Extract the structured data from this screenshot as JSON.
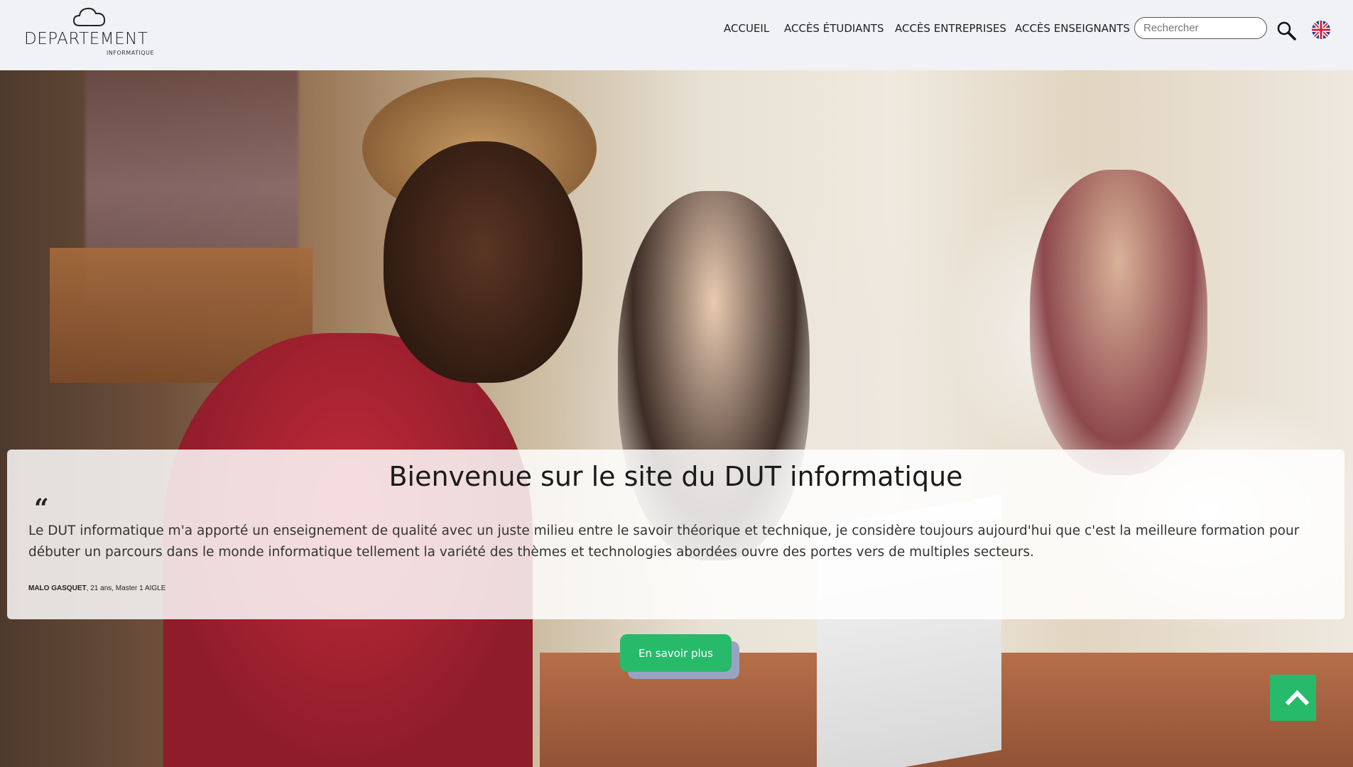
{
  "header": {
    "logo": {
      "title": "DEPARTEMENT",
      "subtitle": "INFORMATIQUE"
    },
    "nav": [
      {
        "label": "ACCUEIL"
      },
      {
        "label": "ACCÈS ÉTUDIANTS"
      },
      {
        "label": "ACCÈS ENTREPRISES"
      },
      {
        "label": "ACCÈS ENSEIGNANTS"
      }
    ],
    "search": {
      "placeholder": "Rechercher",
      "icon": "magnifier-icon"
    },
    "language": {
      "icon": "uk-flag-icon"
    }
  },
  "hero": {
    "title": "Bienvenue sur le site du DUT informatique",
    "quote_mark": "“",
    "quote": "Le DUT informatique m'a apporté un enseignement de qualité avec un juste milieu entre le savoir théorique et technique, je considère toujours aujourd'hui que c'est la meilleure formation pour débuter un parcours dans le monde informatique tellement la variété des thèmes et technologies abordées ouvre des portes vers de multiples secteurs.",
    "author_name": "MALO GASQUET",
    "author_details": ", 21 ans, Master 1 AIGLE",
    "cta_label": "En savoir plus"
  },
  "back_to_top": {
    "icon": "chevron-up-icon"
  },
  "colors": {
    "accent": "#27ba6b",
    "header_bg": "#f1f2f6"
  }
}
